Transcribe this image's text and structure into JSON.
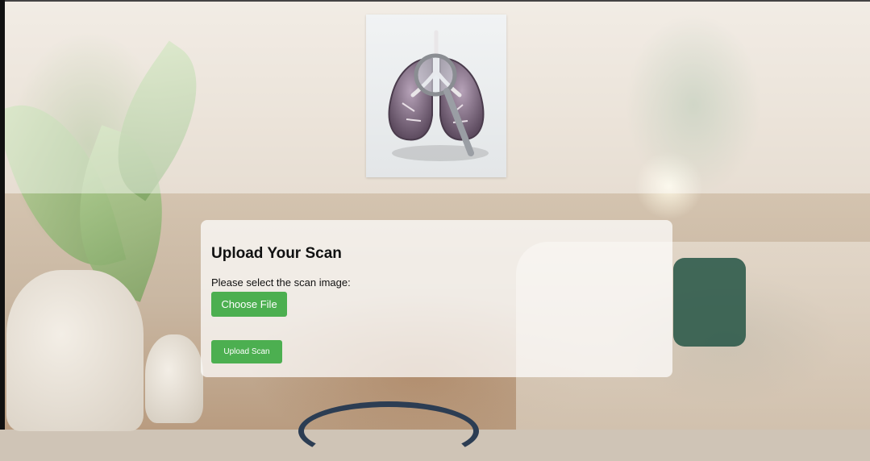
{
  "hero": {
    "alt": "Lungs with magnifying glass"
  },
  "upload_card": {
    "title": "Upload Your Scan",
    "instruction": "Please select the scan image:",
    "choose_file_label": "Choose File",
    "upload_button_label": "Upload Scan"
  },
  "colors": {
    "button_green": "#4caf50",
    "card_background": "rgba(255,255,255,0.72)"
  }
}
